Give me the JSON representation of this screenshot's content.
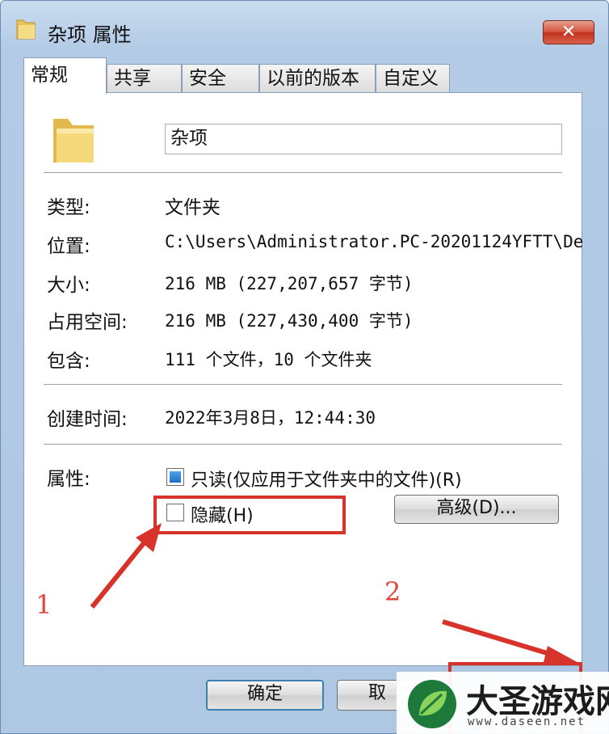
{
  "window": {
    "title": "杂项 属性",
    "close_label": "✕"
  },
  "tabs": [
    {
      "label": "常规",
      "active": true
    },
    {
      "label": "共享"
    },
    {
      "label": "安全"
    },
    {
      "label": "以前的版本"
    },
    {
      "label": "自定义"
    }
  ],
  "general": {
    "name_value": "杂项",
    "type_label": "类型:",
    "type_value": "文件夹",
    "location_label": "位置:",
    "location_value": "C:\\Users\\Administrator.PC-20201124YFTT\\De",
    "size_label": "大小:",
    "size_value": "216 MB (227,207,657 字节)",
    "disk_size_label": "占用空间:",
    "disk_size_value": "216 MB (227,430,400 字节)",
    "contains_label": "包含:",
    "contains_value": "111 个文件，10 个文件夹",
    "created_label": "创建时间:",
    "created_value": "2022年3月8日，12:44:30",
    "attributes_label": "属性:",
    "readonly_label": "只读(仅应用于文件夹中的文件)(R)",
    "hidden_label": "隐藏(H)",
    "advanced_button": "高级(D)..."
  },
  "buttons": {
    "ok": "确定",
    "cancel": "取"
  },
  "annotations": {
    "step1": "1",
    "step2": "2"
  },
  "watermark": {
    "name": "大圣游戏网",
    "url": "www.daseen.net"
  },
  "colors": {
    "annotation_red": "#d7332b",
    "checkbox_blue": "#1b6fc0",
    "title_gradient": "#c9dcf0"
  }
}
